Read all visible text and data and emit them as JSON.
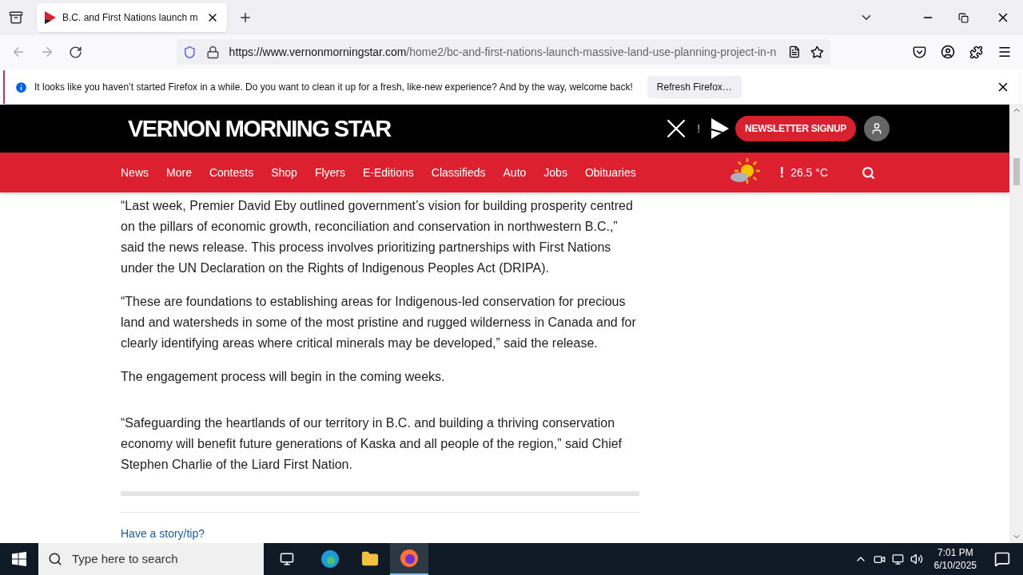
{
  "browser": {
    "tab_title": "B.C. and First Nations launch m",
    "url_host": "https://www.vernonmorningstar.com",
    "url_path": "/home2/bc-and-first-nations-launch-massive-land-use-planning-project-in-n"
  },
  "notification": {
    "message": "It looks like you haven’t started Firefox in a while. Do you want to clean it up for a fresh, like-new experience? And by the way, welcome back!",
    "button": "Refresh Firefox…"
  },
  "site": {
    "logo": "VERNON MORNING STAR",
    "separator": "!",
    "newsletter_button": "NEWSLETTER SIGNUP",
    "nav": [
      {
        "label": "News"
      },
      {
        "label": "More"
      },
      {
        "label": "Contests"
      },
      {
        "label": "Shop"
      },
      {
        "label": "Flyers"
      },
      {
        "label": "E-Editions"
      },
      {
        "label": "Classifieds"
      },
      {
        "label": "Auto"
      },
      {
        "label": "Jobs"
      },
      {
        "label": "Obituaries"
      }
    ],
    "weather_alert": "!",
    "temperature": "26.5 °C"
  },
  "article": {
    "paragraphs": [
      "“Last week, Premier David Eby outlined government’s vision for building prosperity centred on the pillars of economic growth, reconciliation and conservation in northwestern B.C.,” said the news release. This process involves prioritizing partnerships with First Nations under the UN Declaration on the Rights of Indigenous Peoples Act (DRIPA).",
      "“These are foundations to establishing areas for Indigenous-led conservation for precious land and watersheds in some of the most pristine and rugged wilderness in Canada and for clearly identifying areas where critical minerals may be developed,” said the release.",
      "The engagement process will begin in the coming weeks.",
      "“Safeguarding the heartlands of our territory in B.C. and building a thriving conservation economy will benefit future generations of Kaska and all people of the region,” said Chief Stephen Charlie of the Liard First Nation."
    ],
    "tip_link": "Have a story/tip?"
  },
  "taskbar": {
    "search_placeholder": "Type here to search",
    "time": "7:01 PM",
    "date": "6/10/2025"
  }
}
